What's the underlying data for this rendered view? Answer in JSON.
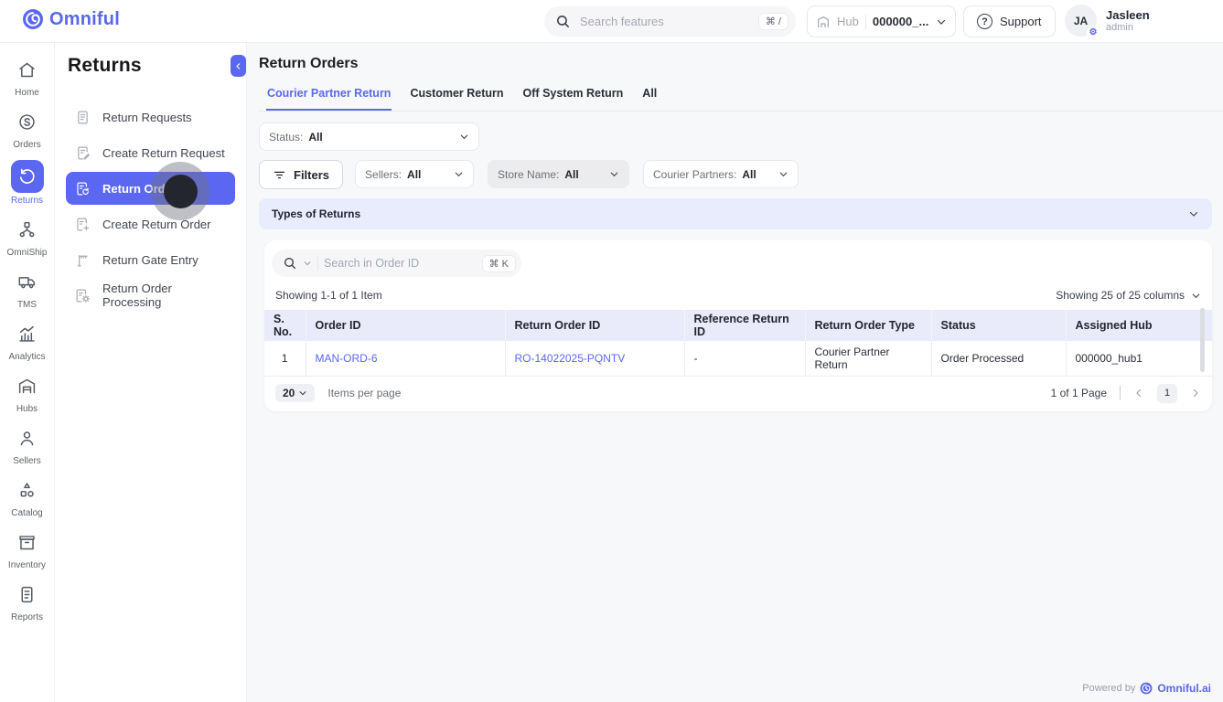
{
  "colors": {
    "accent": "#5B67F1",
    "link": "#5B67F1",
    "active_bg": "#5B67F1"
  },
  "brand": {
    "name": "Omniful"
  },
  "header": {
    "search": {
      "placeholder": "Search features",
      "shortcut": "⌘ /"
    },
    "hub": {
      "label": "Hub",
      "value": "000000_..."
    },
    "support_label": "Support",
    "user": {
      "initials": "JA",
      "name": "Jasleen",
      "role": "admin"
    }
  },
  "primary_nav": {
    "items": [
      {
        "label": "Home"
      },
      {
        "label": "Orders"
      },
      {
        "label": "Returns"
      },
      {
        "label": "OmniShip"
      },
      {
        "label": "TMS"
      },
      {
        "label": "Analytics"
      },
      {
        "label": "Hubs"
      },
      {
        "label": "Sellers"
      },
      {
        "label": "Catalog"
      },
      {
        "label": "Inventory"
      },
      {
        "label": "Reports"
      }
    ],
    "active": "Returns"
  },
  "secondary_nav": {
    "title": "Returns",
    "items": [
      {
        "label": "Return Requests"
      },
      {
        "label": "Create Return Request"
      },
      {
        "label": "Return Orders"
      },
      {
        "label": "Create Return Order"
      },
      {
        "label": "Return Gate Entry"
      },
      {
        "label": "Return Order Processing"
      }
    ],
    "active": "Return Orders"
  },
  "main": {
    "title": "Return Orders",
    "tabs": [
      {
        "label": "Courier Partner Return"
      },
      {
        "label": "Customer Return"
      },
      {
        "label": "Off System Return"
      },
      {
        "label": "All"
      }
    ],
    "active_tab": "Courier Partner Return",
    "filters": {
      "status": {
        "label": "Status:",
        "value": "All"
      },
      "filters_button": "Filters",
      "sellers": {
        "label": "Sellers:",
        "value": "All"
      },
      "store_name": {
        "label": "Store Name:",
        "value": "All"
      },
      "courier_partners": {
        "label": "Courier Partners:",
        "value": "All"
      }
    },
    "types_of_returns_label": "Types of Returns",
    "table": {
      "search_placeholder": "Search in Order ID",
      "search_shortcut": "⌘ K",
      "showing_items": "Showing 1-1 of 1 Item",
      "showing_columns": "Showing 25 of 25 columns",
      "columns": [
        "S. No.",
        "Order ID",
        "Return Order ID",
        "Reference Return ID",
        "Return Order Type",
        "Status",
        "Assigned Hub"
      ],
      "rows": [
        {
          "s_no": "1",
          "order_id": "MAN-ORD-6",
          "return_order_id": "RO-14022025-PQNTV",
          "reference_return_id": "-",
          "return_order_type": "Courier Partner Return",
          "status": "Order Processed",
          "assigned_hub": "000000_hub1"
        }
      ],
      "pagination": {
        "per_page": "20",
        "items_per_page_label": "Items per page",
        "page_info": "1 of 1 Page",
        "current_page": "1"
      }
    }
  },
  "footer": {
    "powered_by": "Powered by",
    "brand": "Omniful.ai"
  }
}
